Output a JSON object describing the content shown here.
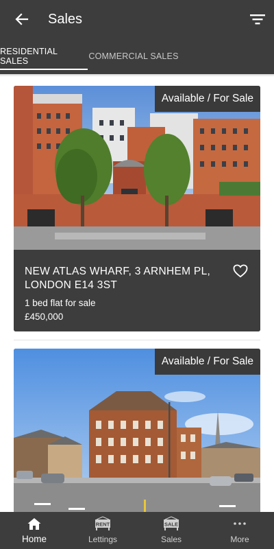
{
  "appbar": {
    "title": "Sales"
  },
  "tabs": [
    {
      "label": "RESIDENTIAL SALES",
      "active": true
    },
    {
      "label": "COMMERCIAL SALES",
      "active": false
    }
  ],
  "listings": [
    {
      "badge": "Available / For Sale",
      "address": "NEW ATLAS WHARF, 3 ARNHEM PL, LONDON E14 3ST",
      "description": "1 bed flat for sale",
      "price": "£450,000"
    },
    {
      "badge": "Available / For Sale"
    }
  ],
  "bottom_nav": [
    {
      "label": "Home",
      "icon": "home-icon",
      "active": true
    },
    {
      "label": "Lettings",
      "icon": "rent-sign-icon",
      "sign_text": "RENT",
      "active": false
    },
    {
      "label": "Sales",
      "icon": "sale-sign-icon",
      "sign_text": "SALE",
      "active": false
    },
    {
      "label": "More",
      "icon": "more-dots-icon",
      "active": false
    }
  ],
  "colors": {
    "bar": "#3d3d3d",
    "text": "#ffffff",
    "inactive_tab": "#c9c9c9"
  }
}
